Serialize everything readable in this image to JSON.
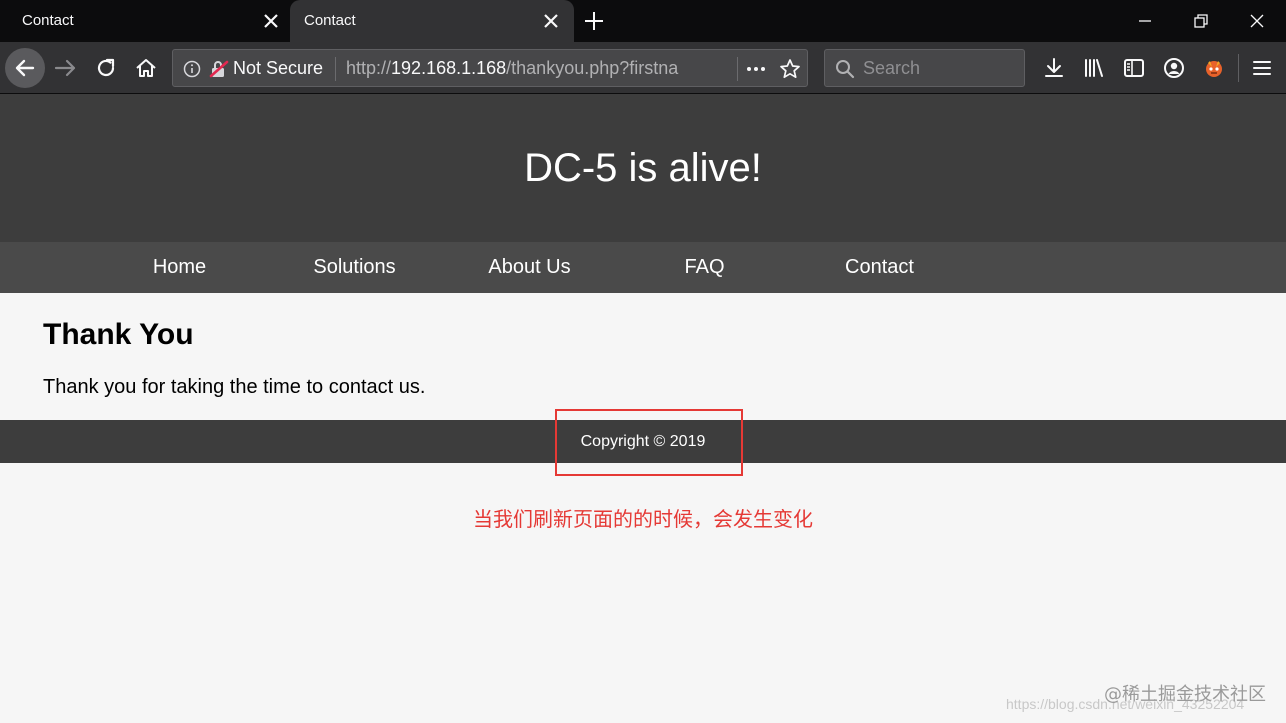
{
  "browser": {
    "tabs": [
      {
        "title": "Contact",
        "active": false
      },
      {
        "title": "Contact",
        "active": true
      }
    ],
    "url": {
      "security_label": "Not Secure",
      "prefix": "http://",
      "host": "192.168.1.168",
      "path": "/thankyou.php?firstname=...",
      "display_path": "/thankyou.php?firstna"
    },
    "search_placeholder": "Search",
    "icons": [
      "back-icon",
      "forward-icon",
      "reload-icon",
      "home-icon",
      "info-icon",
      "insecure-lock-icon",
      "more-icon",
      "bookmark-star-icon",
      "search-icon",
      "download-icon",
      "library-icon",
      "sidebar-icon",
      "account-icon",
      "extension-icon",
      "menu-icon"
    ]
  },
  "site": {
    "title": "DC-5 is alive!",
    "nav": [
      "Home",
      "Solutions",
      "About Us",
      "FAQ",
      "Contact"
    ],
    "heading": "Thank You",
    "message": "Thank you for taking the time to contact us.",
    "footer": "Copyright © 2019"
  },
  "annotation": "当我们刷新页面的的时候，会发生变化",
  "watermarks": {
    "csdn": "https://blog.csdn.net/weixin_43252204",
    "juejin": "@稀土掘金技术社区"
  },
  "colors": {
    "header_bg": "#3d3d3d",
    "nav_bg": "#4a4a4a",
    "highlight": "#e53935"
  }
}
